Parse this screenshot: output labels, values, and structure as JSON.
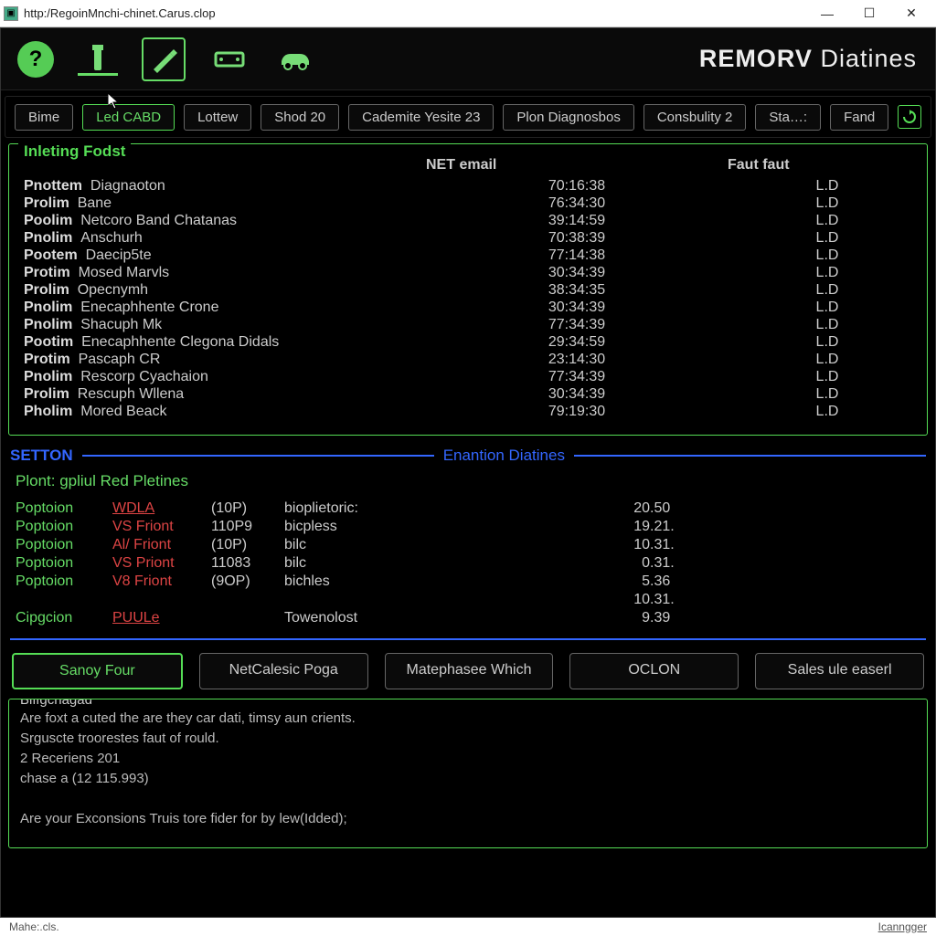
{
  "window": {
    "url": "http:/RegoinMnchi-chinet.Carus.clop",
    "brand_bold": "REMORV",
    "brand_rest": " Diatines"
  },
  "tabs": [
    "Bime",
    "Led CABD",
    "Lottew",
    "Shod 20",
    "Cademite Yesite 23",
    "Plon Diagnosbos",
    "Consbulity 2",
    "Sta…:",
    "Fand"
  ],
  "active_tab": 1,
  "panel1": {
    "title": "Inleting Fodst",
    "headers": [
      "",
      "NET email",
      "Faut faut"
    ],
    "rows": [
      {
        "a": "Pnottem",
        "b": "Diagnaoton",
        "t": "70:16:38",
        "s": "L.D"
      },
      {
        "a": "Prolim",
        "b": "Bane",
        "t": "76:34:30",
        "s": "L.D"
      },
      {
        "a": "Poolim",
        "b": "Netcoro Band Chatanas",
        "t": "39:14:59",
        "s": "L.D"
      },
      {
        "a": "Pnolim",
        "b": "Anschurh",
        "t": "70:38:39",
        "s": "L.D"
      },
      {
        "a": "Pootem",
        "b": "Daecip5te",
        "t": "77:14:38",
        "s": "L.D"
      },
      {
        "a": "Protim",
        "b": "Mosed Marvls",
        "t": "30:34:39",
        "s": "L.D"
      },
      {
        "a": "Prolim",
        "b": "Opecnymh",
        "t": "38:34:35",
        "s": "L.D"
      },
      {
        "a": "Pnolim",
        "b": "Enecaphhente Crone",
        "t": "30:34:39",
        "s": "L.D"
      },
      {
        "a": "Pnolim",
        "b": "Shacuph Mk",
        "t": "77:34:39",
        "s": "L.D"
      },
      {
        "a": "Pootim",
        "b": "Enecaphhente Clegona Didals",
        "t": "29:34:59",
        "s": "L.D"
      },
      {
        "a": "Protim",
        "b": "Pascaph CR",
        "t": "23:14:30",
        "s": "L.D"
      },
      {
        "a": "Pnolim",
        "b": "Rescorp Cyachaion",
        "t": "77:34:39",
        "s": "L.D"
      },
      {
        "a": "Prolim",
        "b": "Rescuph Wllena",
        "t": "30:34:39",
        "s": "L.D"
      },
      {
        "a": "Pholim",
        "b": "Mored Beack",
        "t": "79:19:30",
        "s": "L.D"
      }
    ]
  },
  "divider": {
    "left": "SETTON",
    "mid": "Enantion Diatines"
  },
  "section": {
    "title": "Plont: gpliul Red Pletines",
    "rows": [
      {
        "p1": "Poptoion",
        "p2": "WDLA",
        "p2u": true,
        "p3": "(10P)",
        "p4": "bioplietoric:",
        "p5": "20",
        "p6": ".50"
      },
      {
        "p1": "Poptoion",
        "p2": "VS Friont",
        "p2u": false,
        "p3": "110P9",
        "p4": "bicpless",
        "p5": "19",
        "p6": ".21."
      },
      {
        "p1": "Poptoion",
        "p2": "Al/ Friont",
        "p2u": false,
        "p3": "(10P)",
        "p4": "bilc",
        "p5": "10",
        "p6": ".31."
      },
      {
        "p1": "Poptoion",
        "p2": "VS Priont",
        "p2u": false,
        "p3": "11083",
        "p4": "bilc",
        "p5": "0",
        "p6": ".31."
      },
      {
        "p1": "Poptoion",
        "p2": "V8 Friont",
        "p2u": false,
        "p3": "(9OP)",
        "p4": "bichles",
        "p5": "5",
        "p6": ".36"
      },
      {
        "p1": "",
        "p2": "",
        "p2u": false,
        "p3": "",
        "p4": "",
        "p5": "10",
        "p6": ".31."
      },
      {
        "p1": "Cipgcion",
        "p2": "PUULe",
        "p2u": true,
        "p3": "",
        "p4": "Towenolost",
        "p5": "9",
        "p6": ".39"
      }
    ]
  },
  "actions": [
    "Sanoy Four",
    "NetCalesic Poga",
    "Matephasee Which",
    "OCLON",
    "Sales ule easerl"
  ],
  "active_action": 0,
  "log": {
    "title": "Biffgchagad",
    "lines": [
      "Are foxt a cuted the are they car dati,   timsy aun crients.",
      "Srguscte troorestes faut of rould.",
      "2 Receriens 201",
      "chase a (12 115.993)",
      "",
      "Are your Exconsions Truis tore fider for by lew(Idded);"
    ]
  },
  "status": {
    "left": "Mahe:.cls.",
    "right": "Icanngger"
  }
}
